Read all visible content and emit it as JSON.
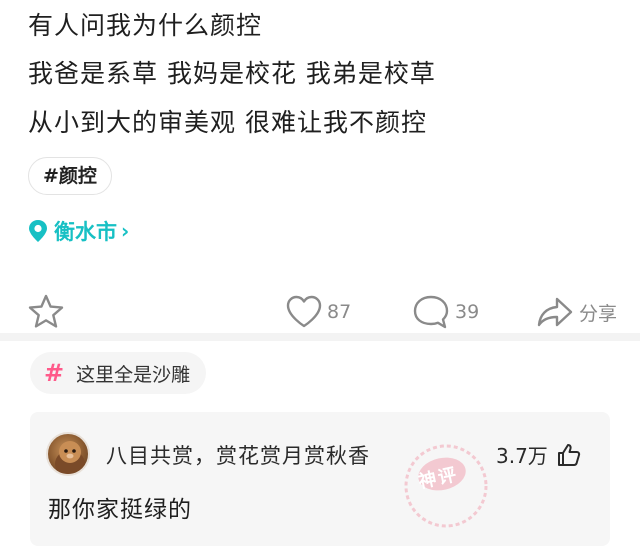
{
  "post": {
    "lines": [
      "有人问我为什么颜控",
      "我爸是系草 我妈是校花 我弟是校草",
      "从小到大的审美观 很难让我不颜控"
    ],
    "hashtag": "#颜控",
    "location": "衡水市",
    "location_chevron": "›"
  },
  "actions": {
    "like_count": "87",
    "comment_count": "39",
    "share_label": "分享"
  },
  "topic": {
    "hash_symbol": "#",
    "label": "这里全是沙雕"
  },
  "comment": {
    "author": "八目共赏，赏花赏月赏秋香",
    "likes": "3.7万",
    "text": "那你家挺绿的",
    "stamp_text": "神评"
  },
  "colors": {
    "accent": "#17c0c4",
    "topic_hash": "#ff5a8a",
    "stamp": "#f2a5b3"
  },
  "icons": [
    "location-pin-icon",
    "star-icon",
    "heart-icon",
    "comment-bubble-icon",
    "share-arrow-icon",
    "thumbs-up-icon"
  ]
}
